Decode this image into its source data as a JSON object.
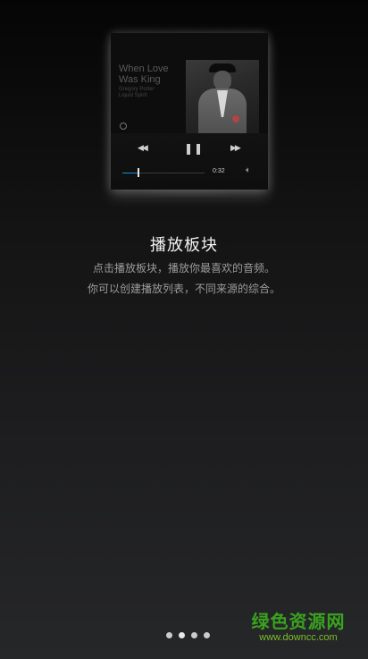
{
  "player_preview": {
    "track_title_line1": "When Love",
    "track_title_line2": "Was King",
    "track_artist_line1": "Gregory Porter",
    "track_artist_line2": "Liquid Spirit",
    "elapsed_time": "0:32",
    "progress": 0.18,
    "progress_color": "#1e8ad6"
  },
  "intro": {
    "headline": "播放板块",
    "description_line1": "点击播放板块，播放你最喜欢的音频。",
    "description_line2": "你可以创建播放列表，不同来源的综合。"
  },
  "pager": {
    "page_count": 4,
    "current_index": 1
  },
  "watermark": {
    "brand": "绿色资源网",
    "url": "www.downcc.com",
    "color": "#3aa21e"
  }
}
